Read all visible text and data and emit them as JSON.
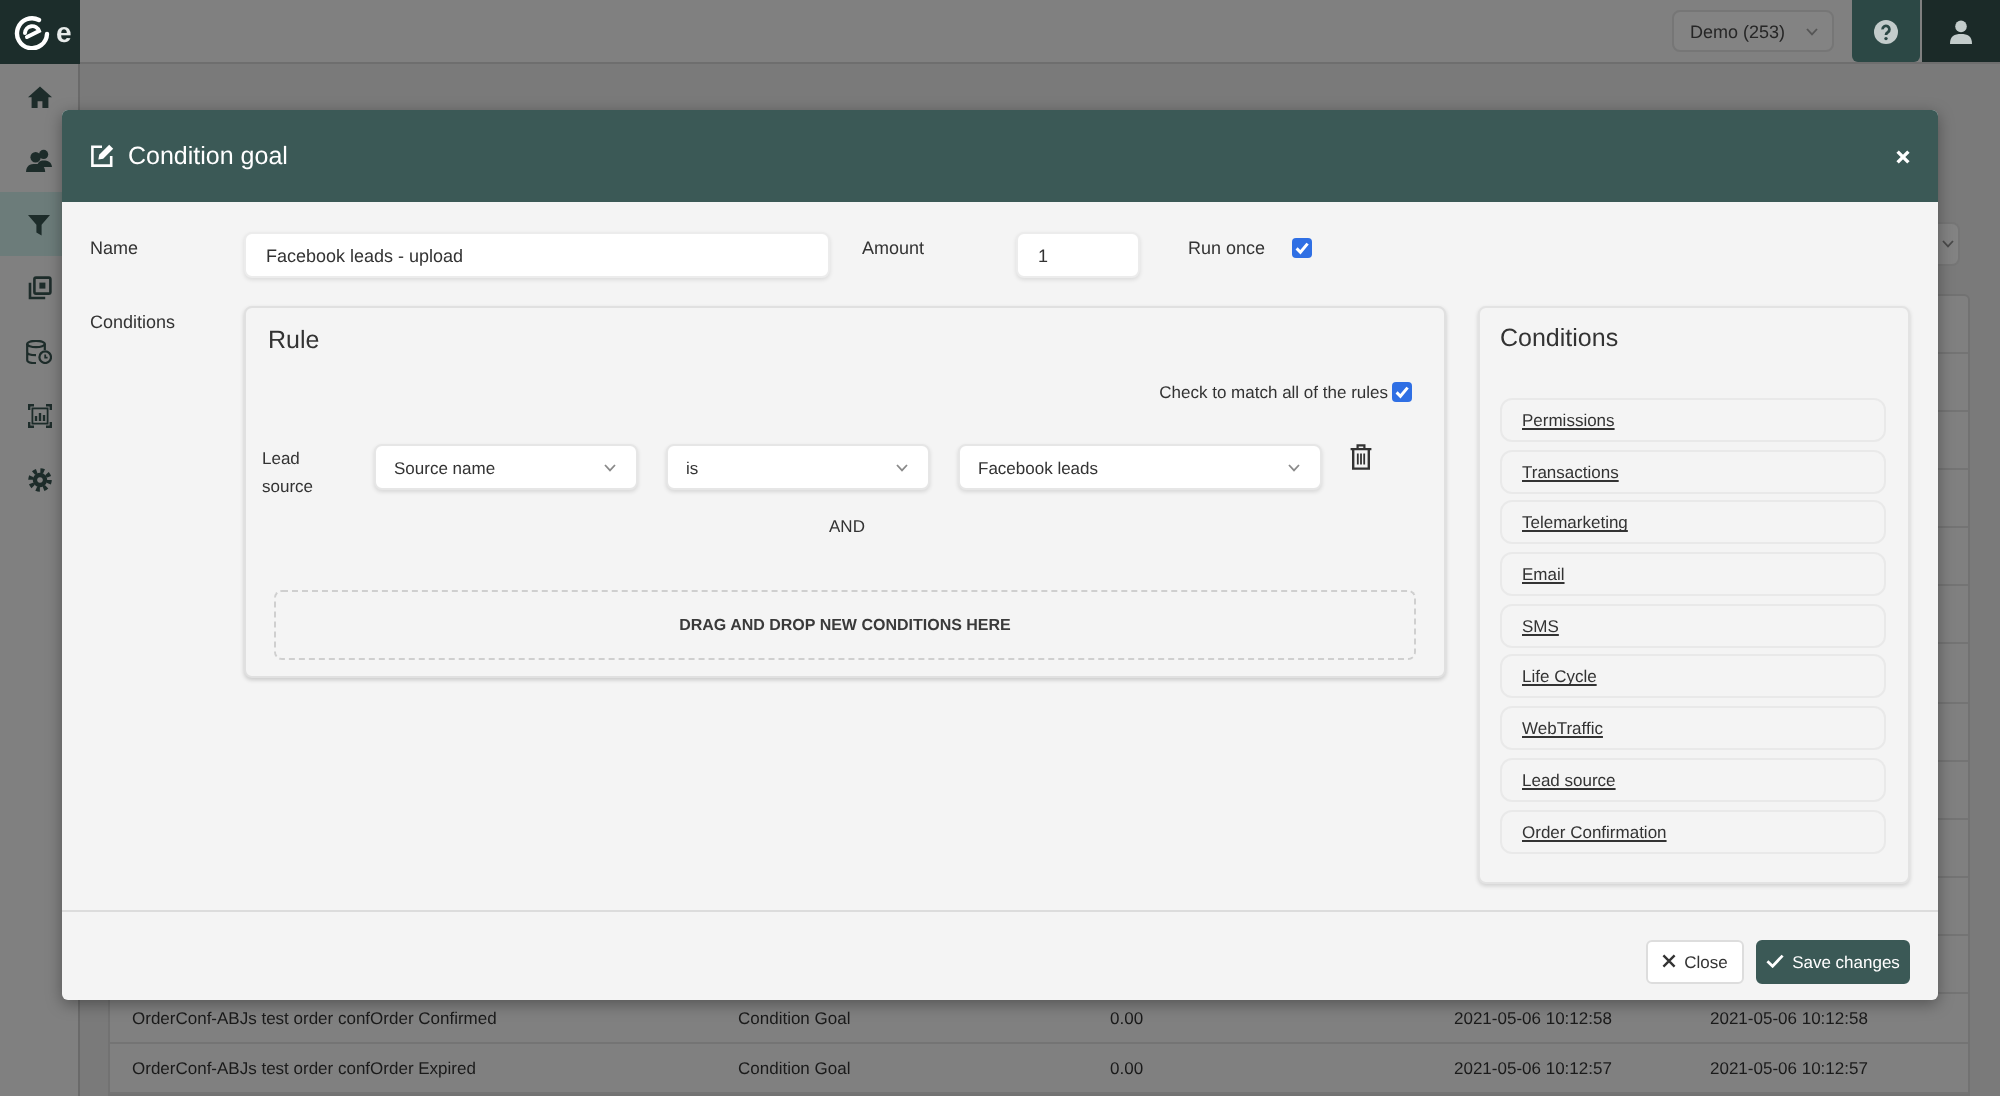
{
  "topbar": {
    "logo_text": "e",
    "account_select": {
      "value": "Demo (253)"
    }
  },
  "sidebar": {
    "items": [
      {
        "selected": false
      },
      {
        "selected": false
      },
      {
        "selected": true
      },
      {
        "selected": false
      },
      {
        "selected": false
      },
      {
        "selected": false
      },
      {
        "selected": false
      }
    ]
  },
  "background_table": {
    "rows": [
      {
        "cells": [
          "OrderConf-ABJs test order confOrder Confirmed",
          "Condition Goal",
          "0.00",
          "2021-05-06 10:12:58",
          "2021-05-06 10:12:58"
        ]
      },
      {
        "cells": [
          "OrderConf-ABJs test order confOrder Expired",
          "Condition Goal",
          "0.00",
          "2021-05-06 10:12:57",
          "2021-05-06 10:12:57"
        ]
      }
    ]
  },
  "modal": {
    "title": "Condition goal",
    "name": {
      "label": "Name",
      "value": "Facebook leads - upload"
    },
    "amount": {
      "label": "Amount",
      "value": "1"
    },
    "run_once": {
      "label": "Run once",
      "checked": true
    },
    "conditions_label": "Conditions",
    "rule": {
      "title": "Rule",
      "match_all": {
        "label": "Check to match all of the rules",
        "checked": true
      },
      "conditions": [
        {
          "label": "Lead source",
          "selects": [
            "Source name",
            "is",
            "Facebook leads"
          ]
        }
      ],
      "joiner": "AND",
      "drop_zone": "DRAG AND DROP NEW CONDITIONS HERE"
    },
    "palette": {
      "title": "Conditions",
      "items": [
        "Permissions",
        "Transactions",
        "Telemarketing",
        "Email",
        "SMS",
        "Life Cycle",
        "WebTraffic",
        "Lead source",
        "Order Confirmation"
      ]
    },
    "buttons": [
      {
        "label": "Close",
        "kind": "secondary"
      },
      {
        "label": "Save changes",
        "kind": "primary"
      }
    ]
  }
}
